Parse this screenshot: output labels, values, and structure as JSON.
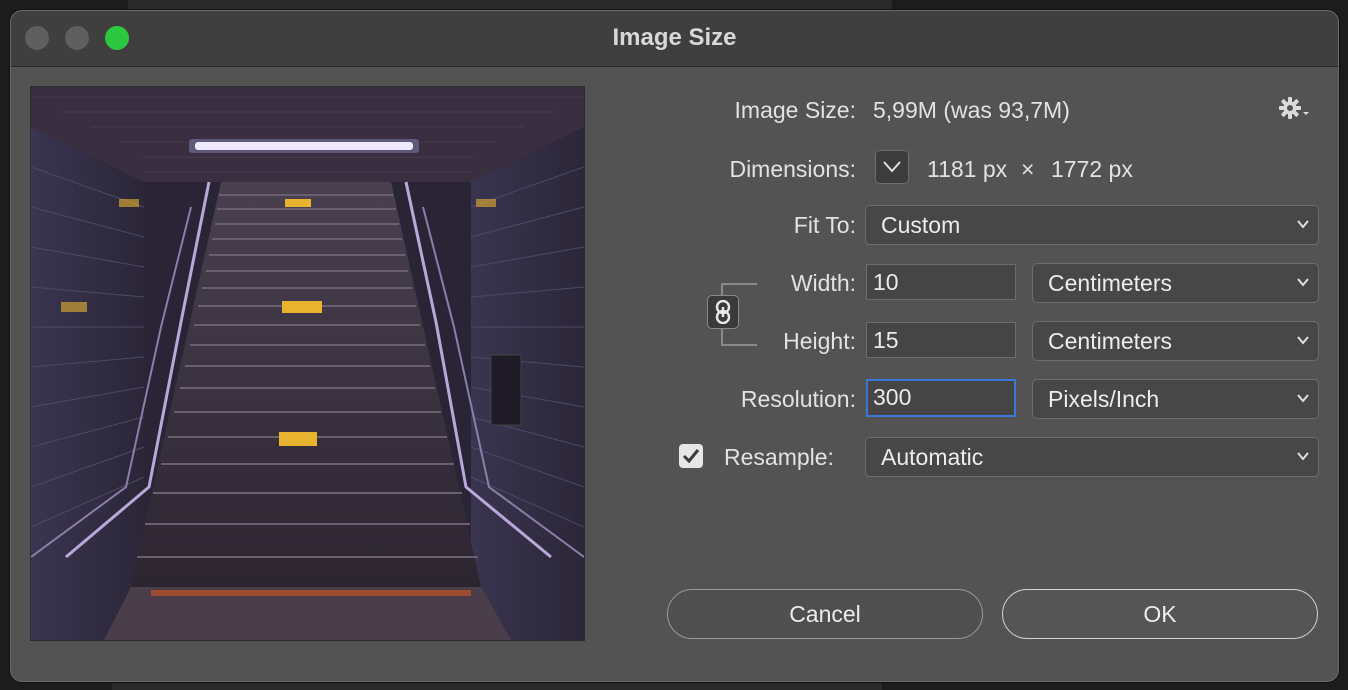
{
  "window": {
    "title": "Image Size"
  },
  "info": {
    "image_size_label": "Image Size:",
    "image_size_value": "5,99M (was 93,7M)",
    "dimensions_label": "Dimensions:",
    "dimensions_width": "1181 px",
    "dimensions_times": "×",
    "dimensions_height": "1772 px"
  },
  "fit_to": {
    "label": "Fit To:",
    "selected": "Custom"
  },
  "width": {
    "label": "Width:",
    "value": "10",
    "unit": "Centimeters"
  },
  "height": {
    "label": "Height:",
    "value": "15",
    "unit": "Centimeters"
  },
  "resolution": {
    "label": "Resolution:",
    "value": "300",
    "unit": "Pixels/Inch"
  },
  "resample": {
    "label": "Resample:",
    "checked": true,
    "selected": "Automatic"
  },
  "buttons": {
    "cancel": "Cancel",
    "ok": "OK"
  },
  "icons": {
    "gear": "gear-icon",
    "dimensions_toggle": "chevron-down-icon",
    "link": "chain-link-icon",
    "checkmark": "checkmark-icon"
  },
  "colors": {
    "accent_focus": "#3a78d8",
    "traffic_green": "#2bc840",
    "dialog_bg": "#535353"
  }
}
